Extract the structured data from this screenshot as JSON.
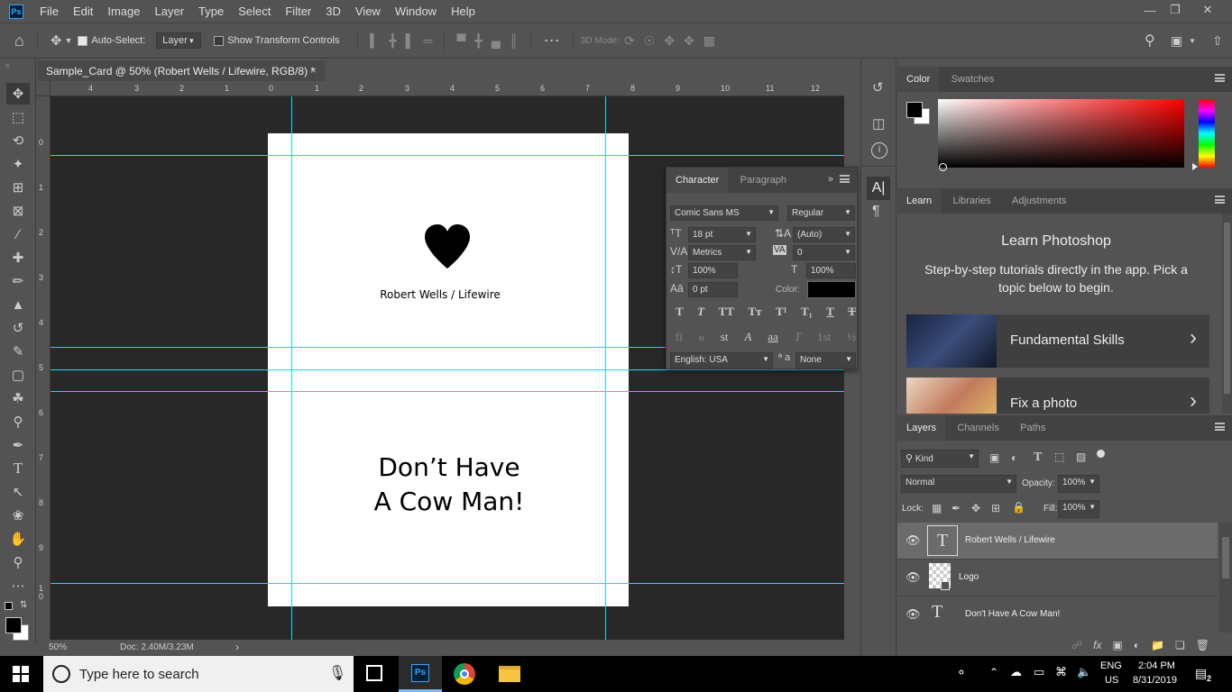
{
  "menubar": {
    "app_logo": "Ps",
    "items": [
      "File",
      "Edit",
      "Image",
      "Layer",
      "Type",
      "Select",
      "Filter",
      "3D",
      "View",
      "Window",
      "Help"
    ]
  },
  "options": {
    "auto_select_label": "Auto-Select:",
    "auto_select_value": "Layer",
    "show_transform_label": "Show Transform Controls",
    "mode_3d_label": "3D Mode:"
  },
  "document": {
    "tab_title": "Sample_Card @ 50% (Robert Wells / Lifewire, RGB/8) *",
    "close": "×",
    "credit_text": "Robert Wells / Lifewire",
    "headline_line1": "Don’t Have",
    "headline_line2": "A Cow Man!",
    "ruler_top": [
      "4",
      "2",
      "0",
      "2",
      "4",
      "6",
      "8",
      "10",
      "12"
    ],
    "ruler_left": [
      "0",
      "1",
      "2",
      "3",
      "4",
      "5",
      "6",
      "7",
      "8",
      "9",
      "1\n0"
    ],
    "ruler_top_hidden": [
      "3",
      "1",
      "1",
      "3",
      "5",
      "7",
      "9",
      "11"
    ]
  },
  "status": {
    "zoom": "50%",
    "doc_size": "Doc: 2.40M/3.23M",
    "arrow": "›"
  },
  "color_panel": {
    "tabs": [
      "Color",
      "Swatches"
    ]
  },
  "learn_panel": {
    "tabs": [
      "Learn",
      "Libraries",
      "Adjustments"
    ],
    "title": "Learn Photoshop",
    "subtitle": "Step-by-step tutorials directly in the app. Pick a topic below to begin.",
    "cards": [
      {
        "label": "Fundamental Skills",
        "chevron": "›"
      },
      {
        "label": "Fix a photo",
        "chevron": "›"
      }
    ]
  },
  "character_panel": {
    "tabs": [
      "Character",
      "Paragraph"
    ],
    "font_family": "Comic Sans MS",
    "font_style": "Regular",
    "size": "18 pt",
    "leading": "(Auto)",
    "kerning": "Metrics",
    "tracking": "0",
    "vscale": "100%",
    "hscale": "100%",
    "baseline": "0 pt",
    "color_label": "Color:",
    "language": "English: USA",
    "aa_label": "ª a",
    "antialias": "None",
    "style_buttons": [
      "T",
      "T",
      "TT",
      "Tт",
      "T¹",
      "T₁",
      "T",
      "T"
    ],
    "opentype_buttons": [
      "fi",
      "ℴ",
      "st",
      "A",
      "aa",
      "T",
      "1st",
      "½"
    ]
  },
  "layers_panel": {
    "tabs": [
      "Layers",
      "Channels",
      "Paths"
    ],
    "filter": "Kind",
    "blend_mode": "Normal",
    "opacity_label": "Opacity:",
    "opacity": "100%",
    "lock_label": "Lock:",
    "fill_label": "Fill:",
    "fill": "100%",
    "layers": [
      {
        "name": "Robert Wells / Lifewire",
        "type": "text",
        "selected": true
      },
      {
        "name": "Logo",
        "type": "smart",
        "selected": false
      },
      {
        "name": "Don't Have A Cow Man!",
        "type": "text",
        "selected": false
      }
    ]
  },
  "taskbar": {
    "search_placeholder": "Type here to search",
    "lang_top": "ENG",
    "lang_bottom": "US",
    "time": "2:04 PM",
    "date": "8/31/2019",
    "notif_count": "2"
  },
  "colors": {
    "guide": "#00e5ff",
    "ps_blue": "#31a8ff",
    "char_color": "#000000"
  }
}
